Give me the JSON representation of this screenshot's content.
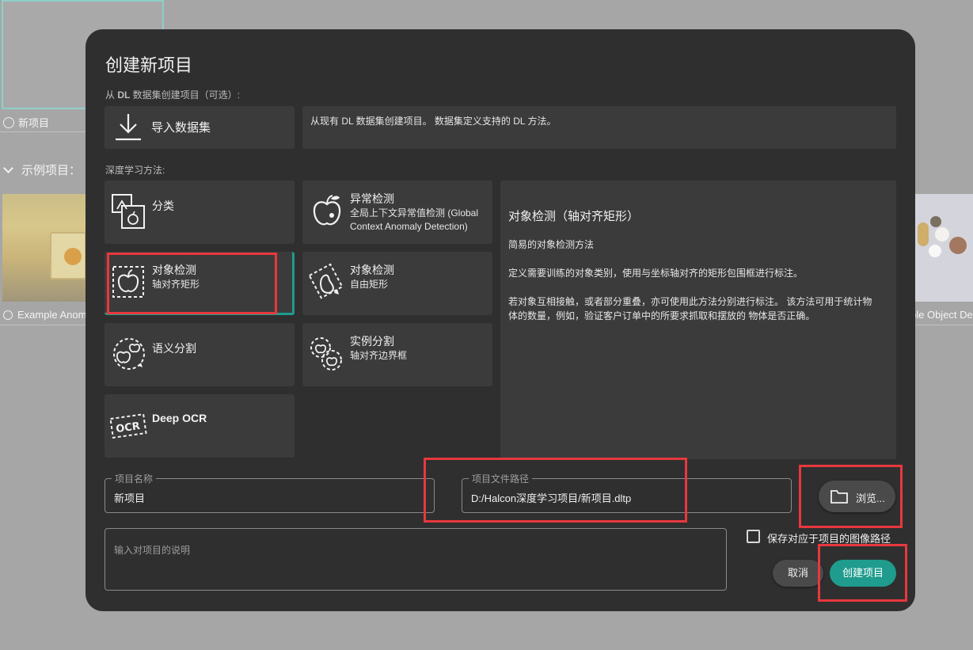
{
  "background": {
    "new_project_label": "新项目",
    "examples_label": "示例项目：",
    "example1_caption": "Example Anom",
    "example2_caption": "ple Object De"
  },
  "dialog": {
    "title": "创建新项目",
    "from_dataset_prefix": "从 ",
    "from_dataset_bold": "DL",
    "from_dataset_suffix": " 数据集创建项目（可选）:",
    "import_label": "导入数据集",
    "import_desc": "从现有 DL 数据集创建项目。 数据集定义支持的 DL 方法。",
    "methods_label": "深度学习方法:",
    "methods": [
      {
        "title": "分类",
        "subtitle": "",
        "icon": "classification-icon"
      },
      {
        "title": "异常检测",
        "subtitle": "全局上下文异常值检测 (Global Context Anomaly Detection)",
        "icon": "anomaly-apple-icon"
      },
      {
        "title": "对象检测",
        "subtitle": "轴对齐矩形",
        "icon": "object-detection-axis-icon",
        "selected": true
      },
      {
        "title": "对象检测",
        "subtitle": "自由矩形",
        "icon": "object-detection-free-icon"
      },
      {
        "title": "语义分割",
        "subtitle": "",
        "icon": "semantic-segmentation-icon"
      },
      {
        "title": "实例分割",
        "subtitle": "轴对齐边界框",
        "icon": "instance-segmentation-icon"
      },
      {
        "title": "Deep OCR",
        "subtitle": "",
        "icon": "ocr-icon"
      }
    ],
    "description": {
      "heading": "对象检测（轴对齐矩形）",
      "p1": "简易的对象检测方法",
      "p2": "定义需要训练的对象类别，使用与坐标轴对齐的矩形包围框进行标注。",
      "p3": "若对象互相接触，或者部分重叠，亦可使用此方法分别进行标注。 该方法可用于统计物体的数量，例如，验证客户订单中的所要求抓取和摆放的 物体是否正确。"
    },
    "project_name": {
      "label": "项目名称",
      "value": "新项目"
    },
    "project_path": {
      "label": "项目文件路径",
      "value": "D:/Halcon深度学习项目/新项目.dltp"
    },
    "browse_label": "浏览...",
    "description_placeholder": "输入对项目的说明",
    "save_paths_label": "保存对应于项目的图像路径",
    "save_paths_checked": false,
    "cancel_label": "取消",
    "create_label": "创建项目"
  },
  "colors": {
    "accent": "#1f9c8e",
    "annotation": "#e8383d"
  }
}
